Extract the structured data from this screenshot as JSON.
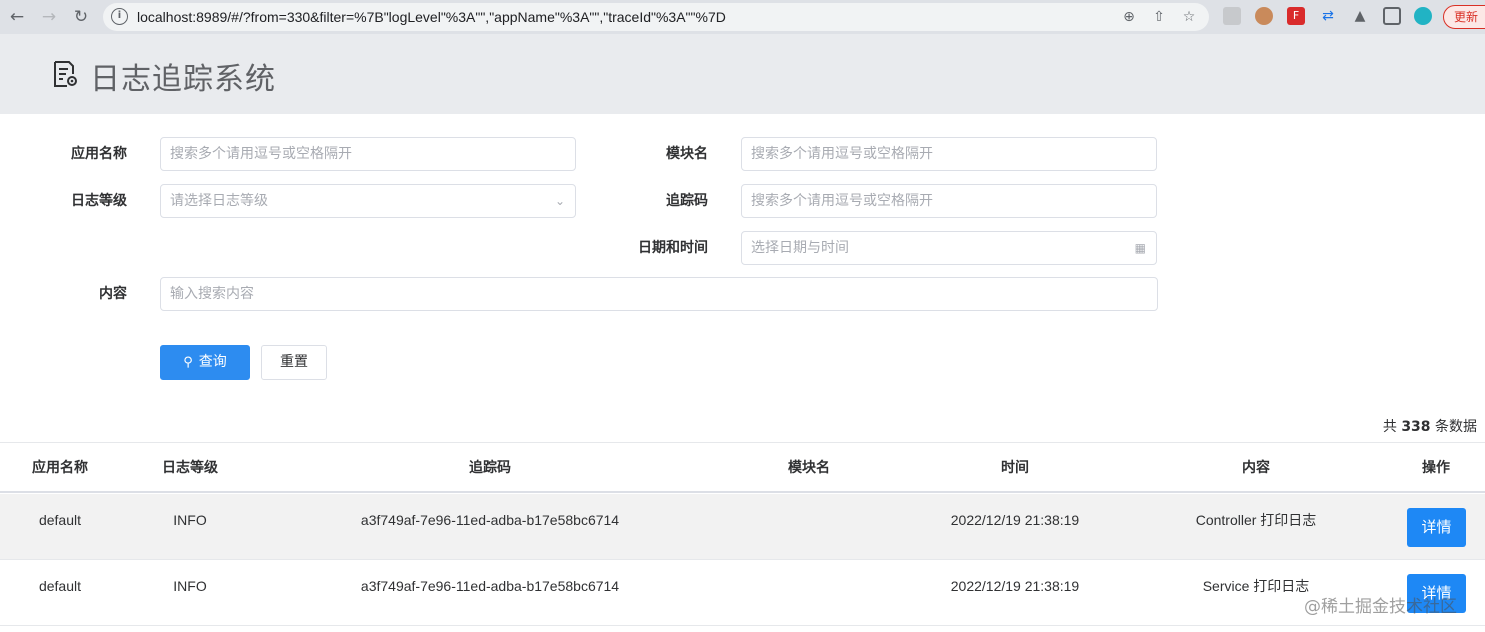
{
  "browser": {
    "url": "localhost:8989/#/?from=330&filter=%7B\"logLevel\"%3A\"\",\"appName\"%3A\"\",\"traceId\"%3A\"\"%7D",
    "update_label": "更新"
  },
  "header": {
    "title": "日志追踪系统"
  },
  "form": {
    "app_name": {
      "label": "应用名称",
      "placeholder": "搜索多个请用逗号或空格隔开"
    },
    "module_name": {
      "label": "模块名",
      "placeholder": "搜索多个请用逗号或空格隔开"
    },
    "log_level": {
      "label": "日志等级",
      "placeholder": "请选择日志等级"
    },
    "trace_id": {
      "label": "追踪码",
      "placeholder": "搜索多个请用逗号或空格隔开"
    },
    "datetime": {
      "label": "日期和时间",
      "placeholder": "选择日期与时间"
    },
    "content": {
      "label": "内容",
      "placeholder": "输入搜索内容"
    },
    "search_label": "查询",
    "reset_label": "重置"
  },
  "summary": {
    "prefix": "共",
    "count": "338",
    "suffix": "条数据"
  },
  "table": {
    "columns": [
      "应用名称",
      "日志等级",
      "追踪码",
      "模块名",
      "时间",
      "内容",
      "操作"
    ],
    "rows": [
      {
        "app": "default",
        "level": "INFO",
        "trace": "a3f749af-7e96-11ed-adba-b17e58bc6714",
        "module": "",
        "time": "2022/12/19 21:38:19",
        "content": "Controller 打印日志",
        "action": "详情"
      },
      {
        "app": "default",
        "level": "INFO",
        "trace": "a3f749af-7e96-11ed-adba-b17e58bc6714",
        "module": "",
        "time": "2022/12/19 21:38:19",
        "content": "Service 打印日志",
        "action": "详情"
      }
    ]
  },
  "watermark": "@稀土掘金技术社区",
  "colors": {
    "primary": "#2d8cf0",
    "header_bg": "#e9ebee",
    "row_alt": "#f2f2f2"
  }
}
